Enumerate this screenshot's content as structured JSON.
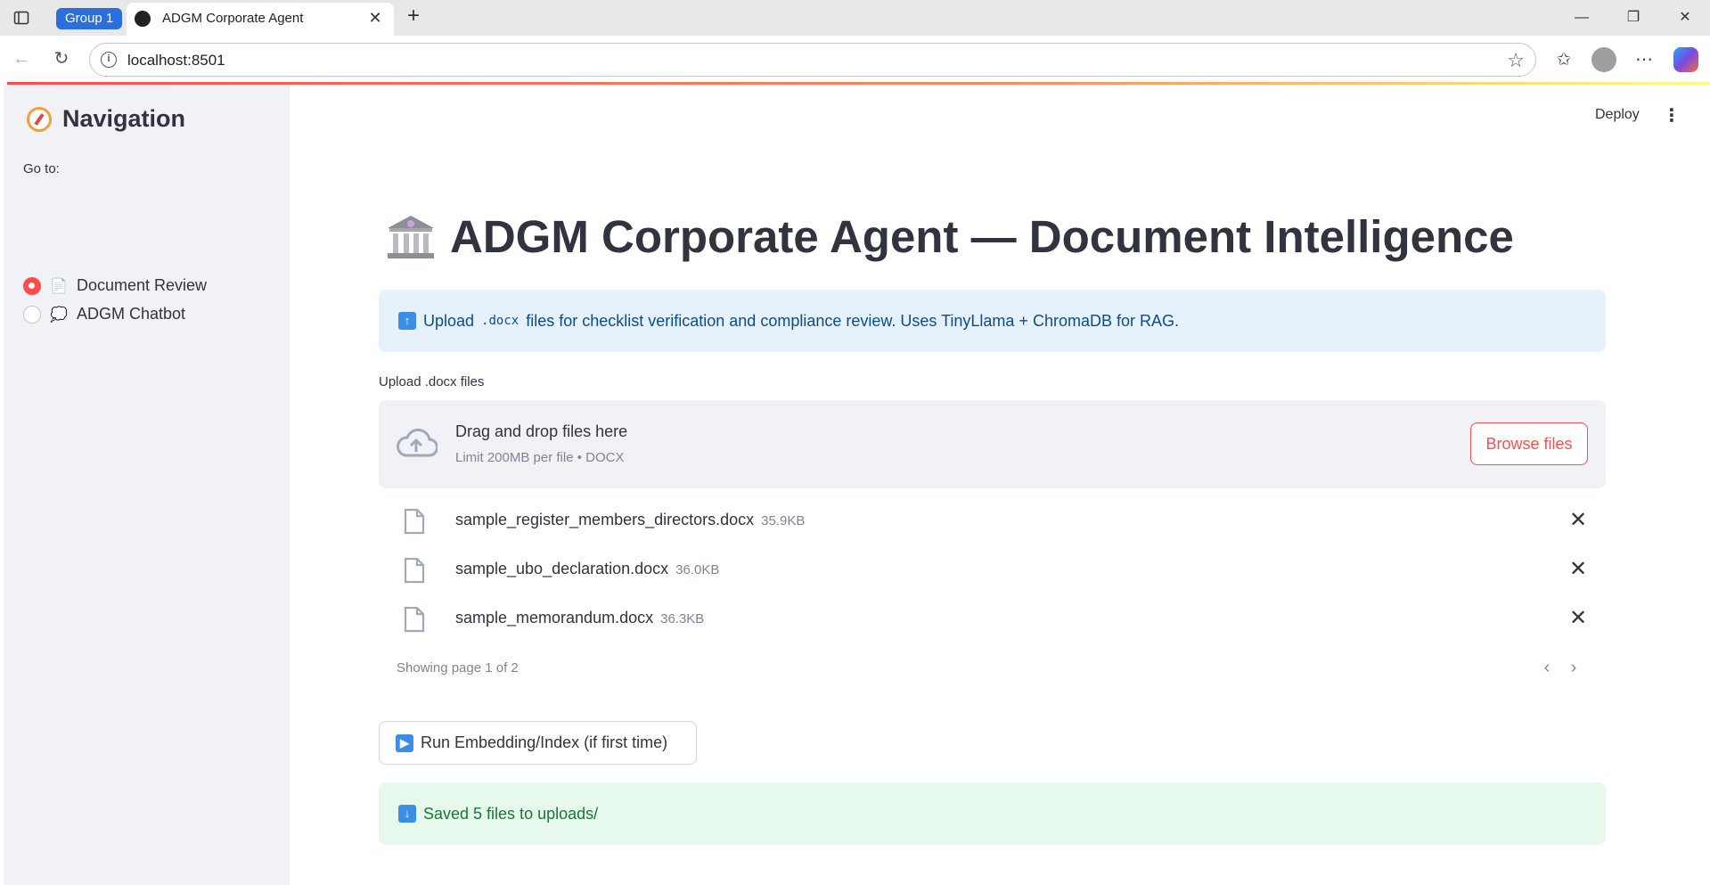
{
  "browser": {
    "group_label": "Group 1",
    "tab_title": "ADGM Corporate Agent",
    "url": "localhost:8501"
  },
  "header": {
    "deploy_label": "Deploy"
  },
  "sidebar": {
    "title": "Navigation",
    "goto_label": "Go to:",
    "options": [
      {
        "label": "Document Review",
        "selected": true
      },
      {
        "label": "ADGM Chatbot",
        "selected": false
      }
    ]
  },
  "main": {
    "title": "ADGM Corporate Agent — Document Intelligence",
    "info": {
      "prefix": "Upload",
      "code": ".docx",
      "suffix": "files for checklist verification and compliance review. Uses TinyLlama + ChromaDB for RAG."
    },
    "uploader": {
      "label": "Upload .docx files",
      "drop_title": "Drag and drop files here",
      "drop_sub": "Limit 200MB per file • DOCX",
      "browse_label": "Browse files"
    },
    "files": [
      {
        "name": "sample_register_members_directors.docx",
        "size": "35.9KB"
      },
      {
        "name": "sample_ubo_declaration.docx",
        "size": "36.0KB"
      },
      {
        "name": "sample_memorandum.docx",
        "size": "36.3KB"
      }
    ],
    "pagination": "Showing page 1 of 2",
    "run_button": "Run Embedding/Index (if first time)",
    "success": "Saved 5 files to uploads/"
  }
}
